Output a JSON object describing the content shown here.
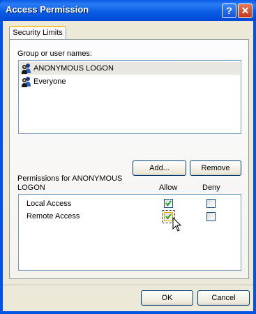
{
  "window": {
    "title": "Access Permission",
    "help_icon": "help-icon",
    "close_icon": "close-icon"
  },
  "tab": {
    "label": "Security Limits"
  },
  "users": {
    "label": "Group or user names:",
    "items": [
      {
        "name": "ANONYMOUS LOGON",
        "icon": "users-icon",
        "selected": true
      },
      {
        "name": "Everyone",
        "icon": "users-icon",
        "selected": false
      }
    ]
  },
  "buttons": {
    "add": "Add...",
    "remove": "Remove",
    "ok": "OK",
    "cancel": "Cancel"
  },
  "permissions": {
    "label": "Permissions for ANONYMOUS LOGON",
    "label_line1": "Permissions for ANONYMOUS",
    "label_line2": "LOGON",
    "col_allow": "Allow",
    "col_deny": "Deny",
    "rows": [
      {
        "name": "Local Access",
        "allow": true,
        "deny": false
      },
      {
        "name": "Remote Access",
        "allow": true,
        "deny": false
      }
    ]
  }
}
